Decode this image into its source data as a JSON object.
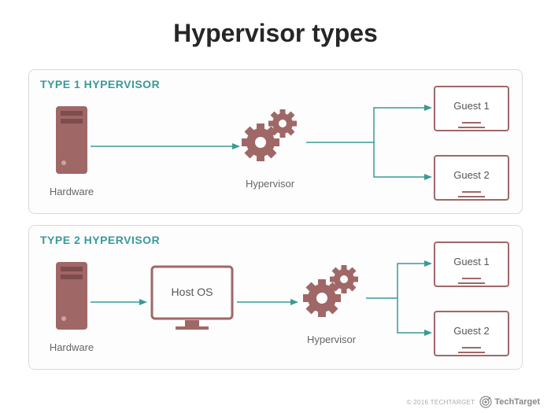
{
  "title": "Hypervisor types",
  "panel1": {
    "title": "TYPE 1 HYPERVISOR",
    "hardware_label": "Hardware",
    "hypervisor_label": "Hypervisor",
    "guest1_label": "Guest 1",
    "guest2_label": "Guest 2"
  },
  "panel2": {
    "title": "TYPE 2 HYPERVISOR",
    "hardware_label": "Hardware",
    "hostos_label": "Host OS",
    "hypervisor_label": "Hypervisor",
    "guest1_label": "Guest 1",
    "guest2_label": "Guest 2"
  },
  "footer": {
    "copyright": "© 2016 TECHTARGET",
    "brand": "TechTarget"
  },
  "colors": {
    "accent_teal": "#3a9a96",
    "icon_maroon": "#a06767",
    "border_gray": "#d9d9d9"
  }
}
